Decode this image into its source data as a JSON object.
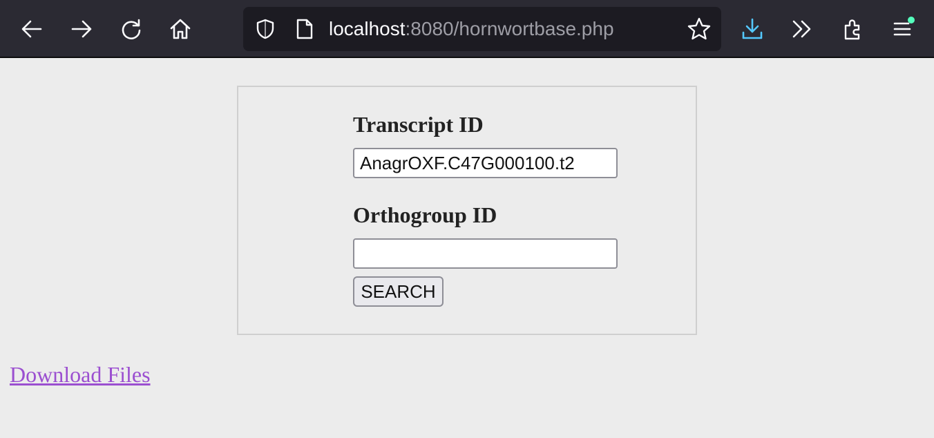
{
  "browser": {
    "url_host": "localhost",
    "url_path": ":8080/hornwortbase.php",
    "toolbar_icons": [
      "back-arrow-icon",
      "forward-arrow-icon",
      "reload-icon",
      "home-icon",
      "shield-icon",
      "page-icon",
      "bookmark-star-icon",
      "downloads-icon",
      "overflow-chevrons-icon",
      "extensions-icon",
      "menu-icon"
    ],
    "accent_color": "#54c8ff",
    "update_dot_color": "#54ffbd"
  },
  "form": {
    "transcript_label": "Transcript ID",
    "transcript_value": "AnagrOXF.C47G000100.t2",
    "orthogroup_label": "Orthogroup ID",
    "orthogroup_value": "",
    "search_button": "SEARCH"
  },
  "links": {
    "download": "Download Files",
    "link_color": "#9b4fd0"
  }
}
